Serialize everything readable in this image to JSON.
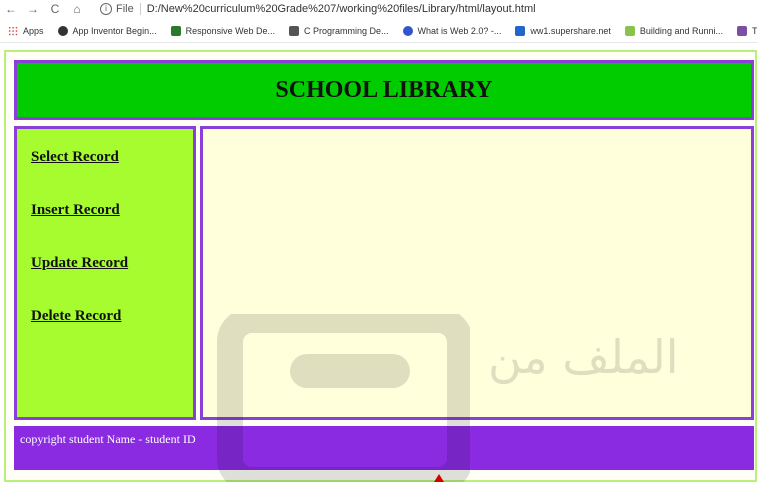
{
  "browser": {
    "back_glyph": "←",
    "forward_glyph": "→",
    "reload_glyph": "C",
    "home_glyph": "⌂",
    "info_glyph": "i",
    "file_label": "File",
    "url": "D:/New%20curriculum%20Grade%207/working%20files/Library/html/layout.html"
  },
  "bookmarks": [
    {
      "label": "Apps",
      "icon": "apps-grid-icon",
      "color": "#d44"
    },
    {
      "label": "App Inventor Begin...",
      "icon": "app-inventor-icon",
      "color": "#333333"
    },
    {
      "label": "Responsive Web De...",
      "icon": "w3-icon",
      "color": "#2a7a2a"
    },
    {
      "label": "C Programming De...",
      "icon": "c-programming-icon",
      "color": "#555555"
    },
    {
      "label": "What is Web 2.0? -...",
      "icon": "infinity-icon",
      "color": "#3355cc"
    },
    {
      "label": "ww1.supershare.net",
      "icon": "s-icon",
      "color": "#2266cc"
    },
    {
      "label": "Building and Runni...",
      "icon": "android-icon",
      "color": "#8bc34a"
    },
    {
      "label": "T",
      "icon": "w-icon",
      "color": "#7b4fa6"
    }
  ],
  "page": {
    "header_title": "SCHOOL LIBRARY",
    "nav_links": [
      "Select Record",
      "Insert Record",
      "Update Record",
      "Delete Record"
    ],
    "footer_text": "copyright student Name - student ID",
    "watermark_text": "الملف من"
  },
  "colors": {
    "header_bg": "#00cc00",
    "sidebar_bg": "#a6fc2e",
    "content_bg": "#ffffdc",
    "footer_bg": "#8a2be2",
    "border": "#8a3fd8",
    "page_border": "#b8f07a"
  }
}
